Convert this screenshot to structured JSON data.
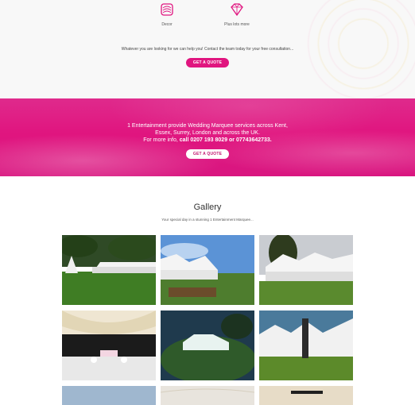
{
  "services": [
    {
      "label": "Decor",
      "icon": "decor-icon"
    },
    {
      "label": "Plus lots more",
      "icon": "diamond-icon"
    }
  ],
  "lead_text": "Whatever you are looking for we can help you! Contact the team today for your free consultation...",
  "cta_top": "GET A QUOTE",
  "band": {
    "line1": "1 Entertainment provide Wedding Marquee services across Kent,",
    "line2": "Essex, Surrey, London and across the UK.",
    "line3_prefix": "For more info, ",
    "line3_phone": "call 0207 193 8029 or 07743642733.",
    "cta": "GET A QUOTE"
  },
  "gallery": {
    "title": "Gallery",
    "subtitle": "Your special day in a stunning 1 Entertainment Marquee..."
  },
  "colors": {
    "brand_pink": "#e0157f",
    "band_pink": "#df2a8c"
  }
}
